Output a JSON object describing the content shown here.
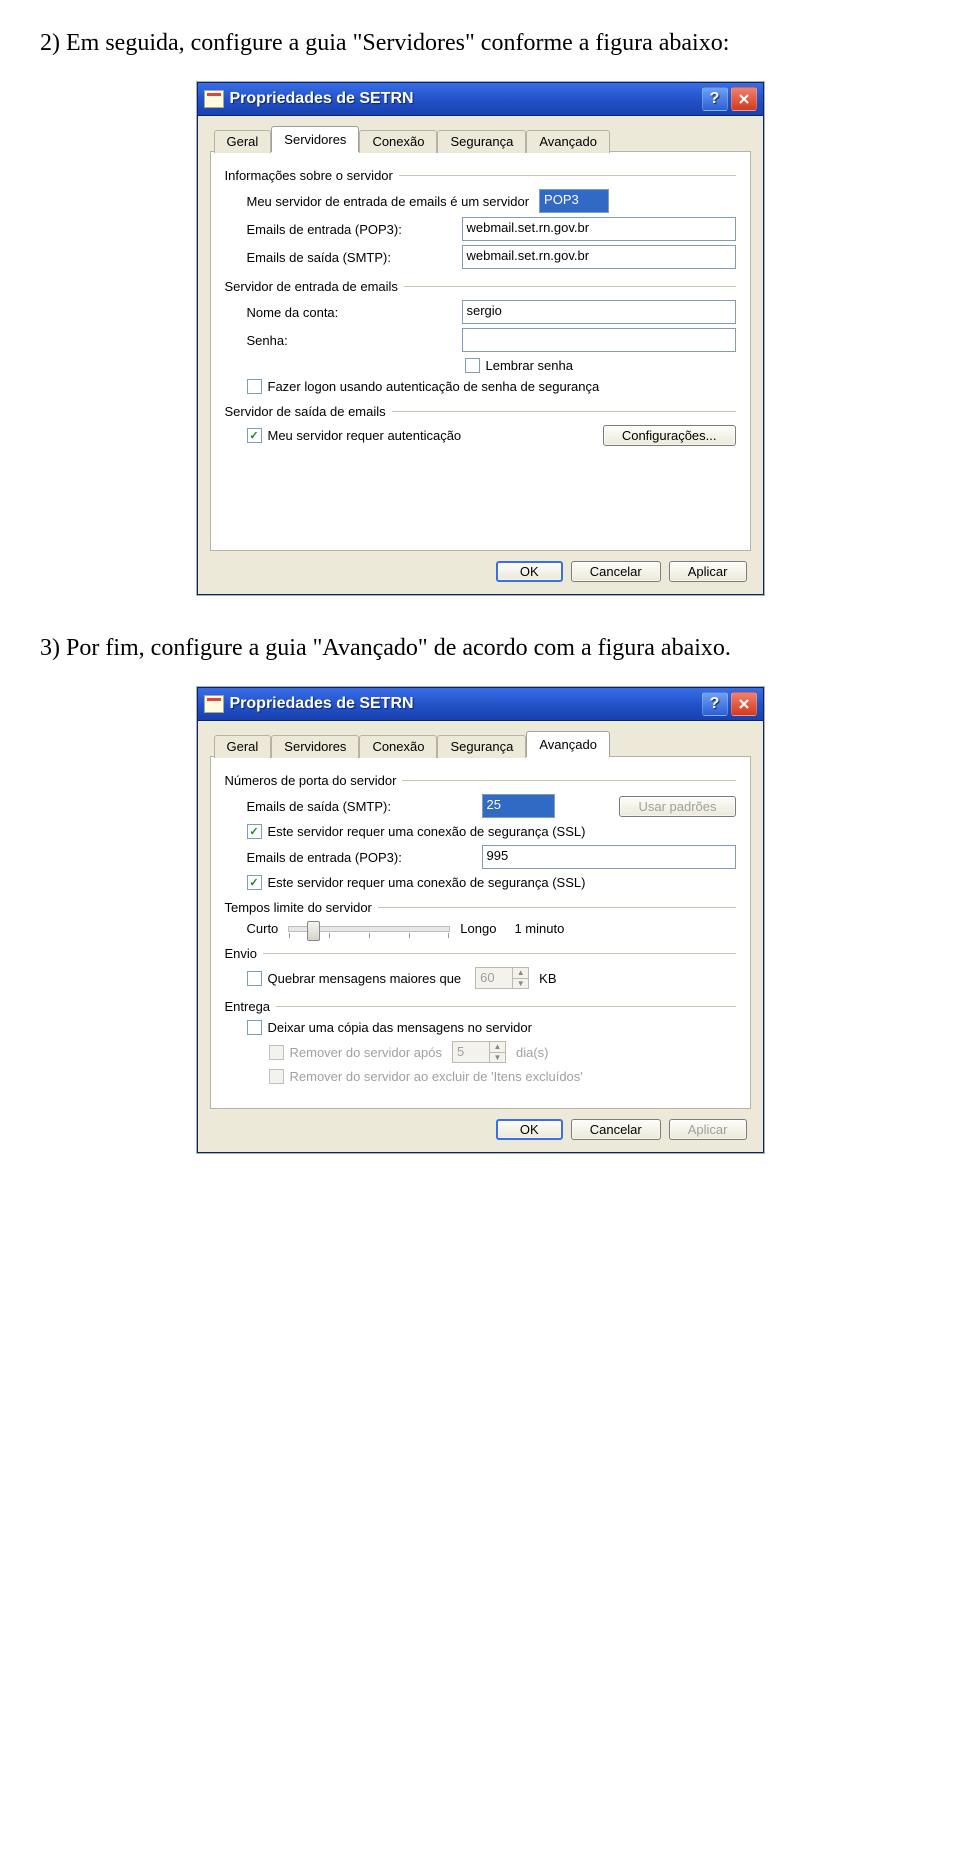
{
  "doc": {
    "step2": "2)  Em seguida, configure a guia \"Servidores\" conforme a figura abaixo:",
    "step3": "3)  Por fim, configure a guia \"Avançado\" de acordo com a figura abaixo."
  },
  "dialog": {
    "title": "Propriedades de SETRN",
    "tabs": [
      "Geral",
      "Servidores",
      "Conexão",
      "Segurança",
      "Avançado"
    ],
    "buttons": {
      "ok": "OK",
      "cancel": "Cancelar",
      "apply": "Aplicar"
    }
  },
  "servidores": {
    "group_info": "Informações sobre o servidor",
    "server_type_label": "Meu servidor de entrada de emails é um servidor",
    "server_type_value": "POP3",
    "incoming_label": "Emails de entrada (POP3):",
    "incoming_value": "webmail.set.rn.gov.br",
    "outgoing_label": "Emails de saída (SMTP):",
    "outgoing_value": "webmail.set.rn.gov.br",
    "group_incoming": "Servidor de entrada de emails",
    "account_label": "Nome da conta:",
    "account_value": "sergio",
    "password_label": "Senha:",
    "password_value": "",
    "remember_label": "Lembrar senha",
    "secure_auth_label": "Fazer logon usando autenticação de senha de segurança",
    "group_outgoing": "Servidor de saída de emails",
    "requires_auth_label": "Meu servidor requer autenticação",
    "config_btn": "Configurações..."
  },
  "avancado": {
    "group_ports": "Números de porta do servidor",
    "smtp_label": "Emails de saída (SMTP):",
    "smtp_value": "25",
    "defaults_btn": "Usar padrões",
    "ssl_out_label": "Este servidor requer uma conexão de segurança (SSL)",
    "pop3_label": "Emails de entrada (POP3):",
    "pop3_value": "995",
    "ssl_in_label": "Este servidor requer uma conexão de segurança (SSL)",
    "group_timeout": "Tempos limite do servidor",
    "timeout_short": "Curto",
    "timeout_long": "Longo",
    "timeout_value": "1 minuto",
    "group_send": "Envio",
    "break_msg_label": "Quebrar mensagens maiores que",
    "break_value": "60",
    "break_unit": "KB",
    "group_delivery": "Entrega",
    "leave_copy_label": "Deixar uma cópia das mensagens no servidor",
    "remove_after_label": "Remover do servidor após",
    "remove_after_value": "5",
    "remove_after_unit": "dia(s)",
    "remove_deleted_label": "Remover do servidor ao excluir de 'Itens excluídos'"
  }
}
